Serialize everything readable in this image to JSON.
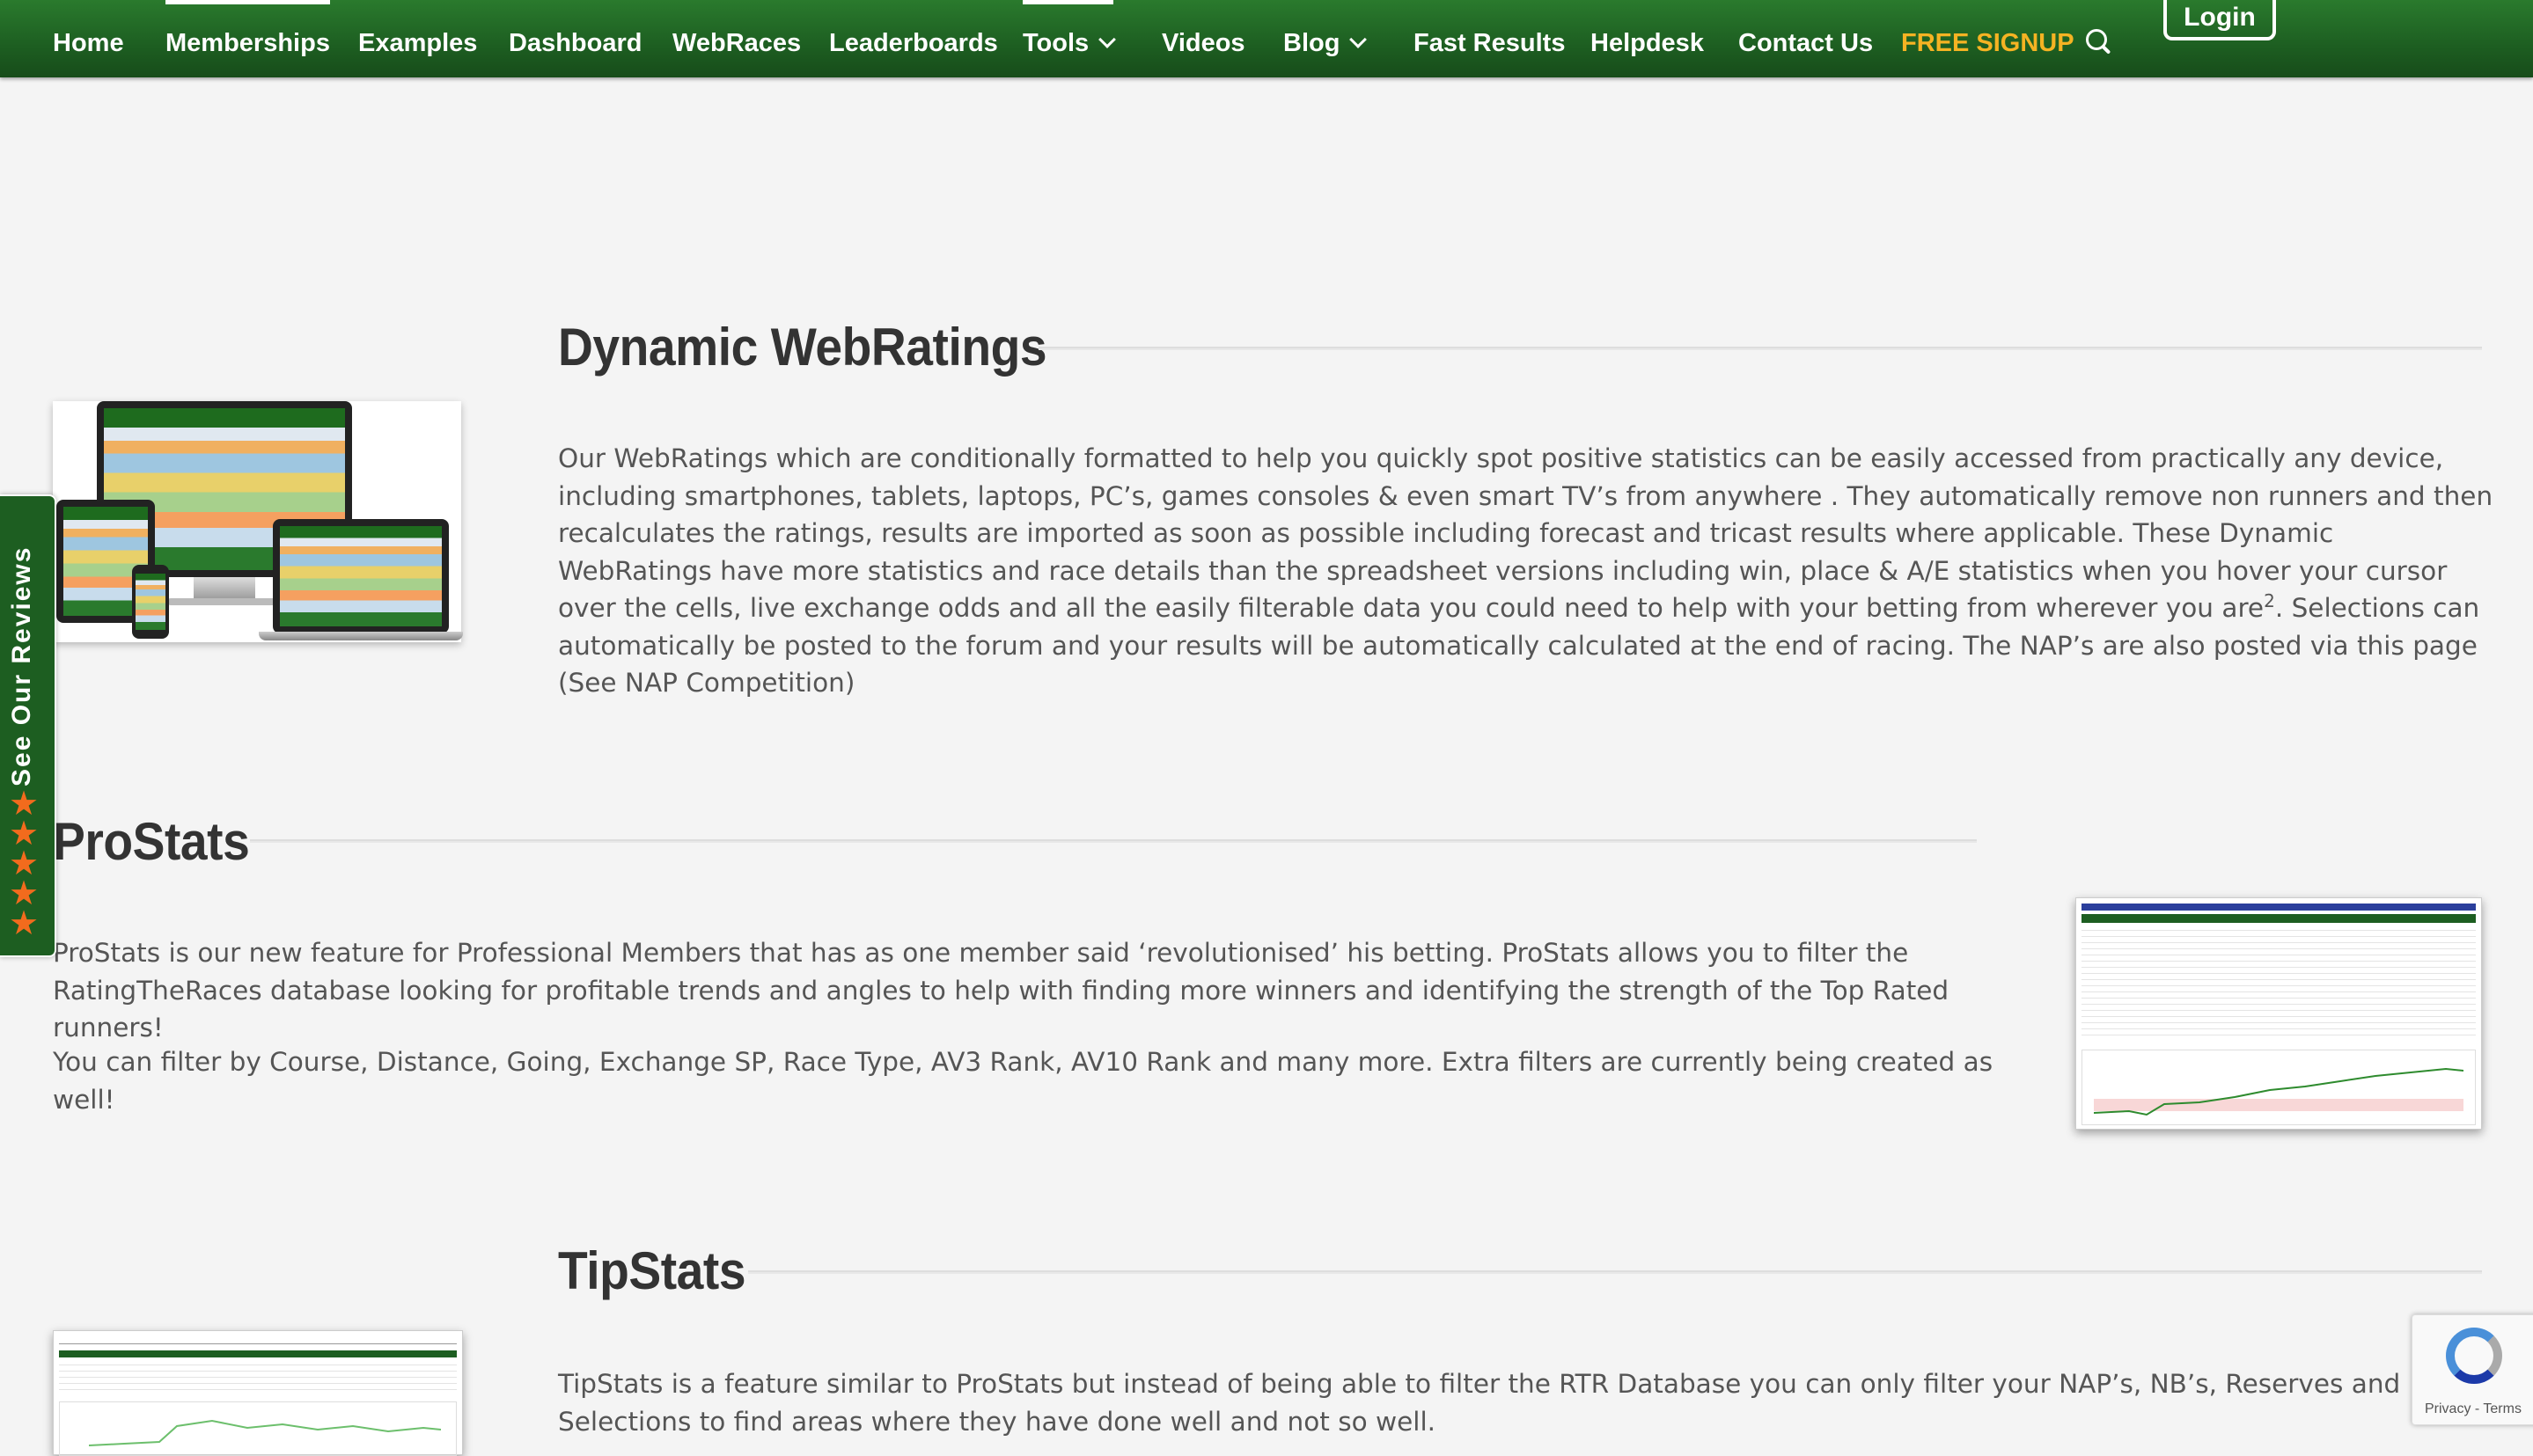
{
  "nav": {
    "items": [
      {
        "label": "Home"
      },
      {
        "label": "Memberships"
      },
      {
        "label": "Examples"
      },
      {
        "label": "Dashboard"
      },
      {
        "label": "WebRaces"
      },
      {
        "label": "Leaderboards"
      },
      {
        "label": "Tools"
      },
      {
        "label": "Videos"
      },
      {
        "label": "Blog"
      },
      {
        "label": "Fast Results"
      },
      {
        "label": "Helpdesk"
      },
      {
        "label": "Contact Us"
      },
      {
        "label": "FREE SIGNUP"
      }
    ],
    "active": [
      "Memberships",
      "Tools"
    ],
    "search_icon": "search-icon",
    "login_label": "Login",
    "signup_color": "#f5b323"
  },
  "sections": {
    "webratings": {
      "title": "Dynamic WebRatings",
      "text_before_sup": "Our WebRatings which are conditionally formatted to help you quickly spot positive statistics can be easily accessed from practically any device, including smartphones, tablets, laptops, PC’s, games consoles & even smart TV’s from anywhere . They automatically remove non runners and then recalculates the ratings, results are imported as soon as possible including forecast and tricast results where applicable. These Dynamic WebRatings have more statistics and race details than the spreadsheet versions including win, place & A/E statistics when you hover your cursor over the cells, live exchange odds and all the easily filterable data you could need to help with your betting from wherever you are",
      "sup": "2",
      "text_after_sup": ". Selections can automatically be posted to the forum and your results will be automatically calculated at the end of racing. The NAP’s are also posted via this page (See NAP Competition)"
    },
    "prostats": {
      "title": "ProStats",
      "para1": "ProStats is our new feature for Professional Members that has as one member said ‘revolutionised’ his betting. ProStats allows you to filter the RatingTheRaces database looking for profitable trends and angles to help with finding more winners and identifying the strength of the Top Rated runners!",
      "para2": "You can filter by Course, Distance, Going, Exchange SP, Race Type, AV3 Rank, AV10 Rank and many more. Extra filters are currently being created as well!"
    },
    "tipstats": {
      "title": "TipStats",
      "para1": "TipStats is a feature similar to ProStats but instead of being able to filter the RTR Database you can only filter your NAP’s, NB’s, Reserves and Selections to find areas where they have done well and not so well."
    }
  },
  "reviews_tab": {
    "label": "See Our Reviews",
    "stars": 5,
    "star_color": "#f26b1d"
  },
  "recaptcha": {
    "links": "Privacy - Terms"
  },
  "colors": {
    "nav_green": "#1d5e21",
    "page_bg": "#f4f4f4",
    "heading": "#333333",
    "body_text": "#555555"
  }
}
